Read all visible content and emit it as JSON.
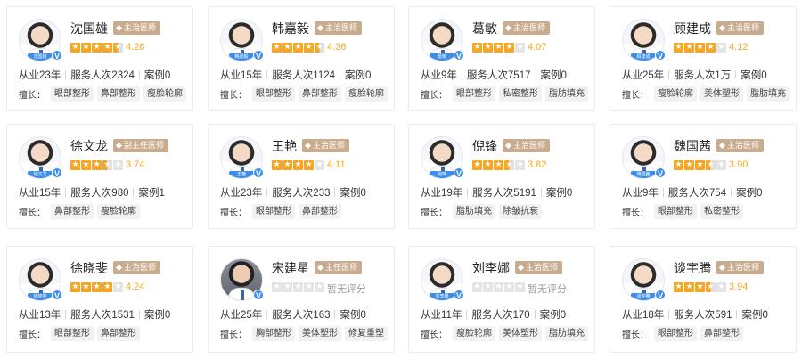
{
  "doctors": [
    {
      "name": "沈国雄",
      "title": "主治医师",
      "rating": 4.28,
      "score_text": "4.28",
      "years": "从业23年",
      "services": "服务人次2324",
      "cases": "案例0",
      "skills": [
        "眼部整形",
        "鼻部整形",
        "瘦脸轮廓"
      ],
      "avatar_label": "沈国雄"
    },
    {
      "name": "韩嘉毅",
      "title": "主治医师",
      "rating": 4.36,
      "score_text": "4.36",
      "years": "从业15年",
      "services": "服务人次1124",
      "cases": "案例0",
      "skills": [
        "眼部整形",
        "鼻部整形",
        "瘦脸轮廓"
      ],
      "avatar_label": "韩嘉毅"
    },
    {
      "name": "葛敏",
      "title": "主治医师",
      "rating": 4.07,
      "score_text": "4.07",
      "years": "从业9年",
      "services": "服务人次7517",
      "cases": "案例0",
      "skills": [
        "眼部整形",
        "私密整形",
        "脂肪填充"
      ],
      "avatar_label": "葛敏"
    },
    {
      "name": "顾建成",
      "title": "主治医师",
      "rating": 4.12,
      "score_text": "4.12",
      "years": "从业25年",
      "services": "服务人次1万",
      "cases": "案例0",
      "skills": [
        "瘦脸轮廓",
        "美体塑形",
        "脂肪填充"
      ],
      "avatar_label": "顾建成"
    },
    {
      "name": "徐文龙",
      "title": "副主任医师",
      "rating": 3.74,
      "score_text": "3.74",
      "years": "从业15年",
      "services": "服务人次980",
      "cases": "案例1",
      "skills": [
        "鼻部整形",
        "瘦脸轮廓"
      ],
      "avatar_label": "徐文龙"
    },
    {
      "name": "王艳",
      "title": "主治医师",
      "rating": 4.11,
      "score_text": "4.11",
      "years": "从业23年",
      "services": "服务人次233",
      "cases": "案例0",
      "skills": [
        "眼部整形",
        "鼻部整形"
      ],
      "avatar_label": "王艳"
    },
    {
      "name": "倪锋",
      "title": "主治医师",
      "rating": 3.82,
      "score_text": "3.82",
      "years": "从业19年",
      "services": "服务人次5191",
      "cases": "案例0",
      "skills": [
        "脂肪填充",
        "除皱抗衰"
      ],
      "avatar_label": "倪锋"
    },
    {
      "name": "魏国茜",
      "title": "主治医师",
      "rating": 3.9,
      "score_text": "3.90",
      "years": "从业9年",
      "services": "服务人次754",
      "cases": "案例0",
      "skills": [
        "眼部整形",
        "私密整形"
      ],
      "avatar_label": "魏国茜"
    },
    {
      "name": "徐晓斐",
      "title": "主治医师",
      "rating": 4.24,
      "score_text": "4.24",
      "years": "从业13年",
      "services": "服务人次1531",
      "cases": "案例0",
      "skills": [
        "眼部整形",
        "鼻部整形"
      ],
      "avatar_label": "徐晓斐"
    },
    {
      "name": "宋建星",
      "title": "主任医师",
      "rating": 0,
      "score_text": "暂无评分",
      "years": "从业25年",
      "services": "服务人次163",
      "cases": "案例0",
      "skills": [
        "胸部整形",
        "美体塑形",
        "修复重塑"
      ],
      "avatar_label": ""
    },
    {
      "name": "刘李娜",
      "title": "主治医师",
      "rating": 0,
      "score_text": "暂无评分",
      "years": "从业11年",
      "services": "服务人次170",
      "cases": "案例0",
      "skills": [
        "瘦脸轮廓",
        "美体塑形",
        "脂肪填充"
      ],
      "avatar_label": "刘李娜"
    },
    {
      "name": "谈宇腾",
      "title": "主治医师",
      "rating": 3.94,
      "score_text": "3.94",
      "years": "从业18年",
      "services": "服务人次591",
      "cases": "案例0",
      "skills": [
        "眼部整形",
        "鼻部整形"
      ],
      "avatar_label": "谈宇腾"
    }
  ],
  "skills_label": "擅长：",
  "verified_mark": "V",
  "colors": {
    "star": "#f5a623",
    "badge": "#c9ac8e",
    "verified": "#3d8ee8"
  }
}
